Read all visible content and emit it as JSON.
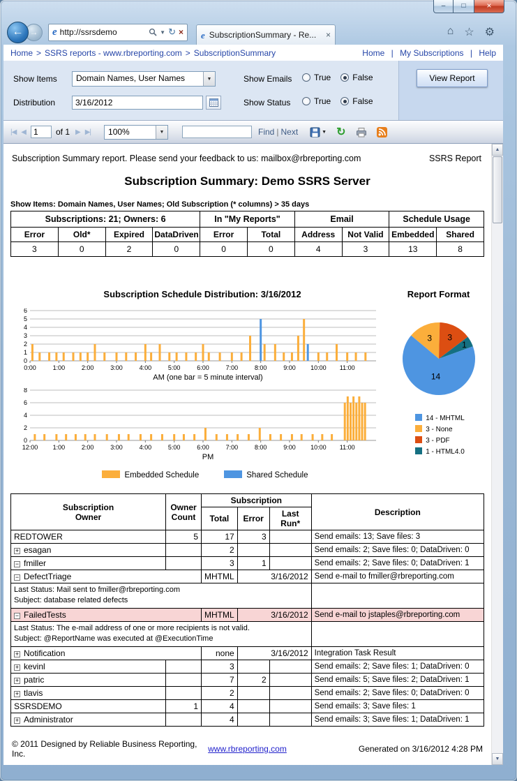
{
  "colors": {
    "embedded": "#FBAE3B",
    "shared": "#4E95E1",
    "pie_mhtml": "#4E95E1",
    "pie_none": "#FBAE3B",
    "pie_pdf": "#DC4E12",
    "pie_html40": "#157082",
    "row_highlight": "#F8D5D5",
    "link": "#2646A8"
  },
  "icons": {
    "favicon": "e",
    "back": "←",
    "forward": "→",
    "dropdown": "▼",
    "refresh": "↻",
    "stop": "×",
    "home": "⌂",
    "favorites": "☆",
    "tools": "⚙",
    "minimize": "–",
    "maximize": "□",
    "close": "×",
    "nav_first": "|◀",
    "nav_prev": "◀",
    "nav_next": "▶",
    "nav_last": "▶|",
    "scroll_up": "▲",
    "scroll_down": "▼"
  },
  "browser": {
    "address": "http://ssrsdemo",
    "tab_title": "SubscriptionSummary - Re..."
  },
  "breadcrumb": {
    "items": [
      "Home",
      "SSRS reports - www.rbreporting.com",
      "SubscriptionSummary"
    ],
    "separator": ">",
    "right_items": [
      "Home",
      "My Subscriptions",
      "Help"
    ],
    "right_separator": "|"
  },
  "parameters": {
    "show_items": {
      "label": "Show Items",
      "value": "Domain Names, User Names"
    },
    "show_emails": {
      "label": "Show Emails",
      "true_label": "True",
      "false_label": "False",
      "value": "False"
    },
    "distribution": {
      "label": "Distribution",
      "value": "3/16/2012"
    },
    "show_status": {
      "label": "Show Status",
      "true_label": "True",
      "false_label": "False",
      "value": "False"
    },
    "view_report": "View Report"
  },
  "toolbar": {
    "page": "1",
    "of": "of 1",
    "zoom": "100%",
    "find_value": "",
    "find": "Find",
    "next": "Next",
    "separator": "|"
  },
  "report": {
    "feedback": "Subscription Summary report. Please send your feedback to us: mailbox@rbreporting.com",
    "corner": "SSRS Report",
    "title": "Subscription Summary: Demo SSRS Server",
    "filter_line": "Show Items: Domain Names, User Names; Old Subscription (* columns) > 35 days",
    "footer": {
      "copyright": "© 2011 Designed by Reliable Business Reporting, Inc.",
      "link": "www.rbreporting.com",
      "generated": "Generated on 3/16/2012 4:28 PM"
    }
  },
  "summary_table": {
    "groups": [
      {
        "label": "Subscriptions: 21; Owners: 6",
        "columns": [
          [
            "Error",
            "3"
          ],
          [
            "Old*",
            "0"
          ],
          [
            "Expired",
            "2"
          ],
          [
            "DataDriven",
            "0"
          ]
        ]
      },
      {
        "label": "In \"My Reports\"",
        "columns": [
          [
            "Error",
            "0"
          ],
          [
            "Total",
            "0"
          ]
        ]
      },
      {
        "label": "Email",
        "columns": [
          [
            "Address",
            "4"
          ],
          [
            "Not Valid",
            "3"
          ]
        ]
      },
      {
        "label": "Schedule Usage",
        "columns": [
          [
            "Embedded",
            "13"
          ],
          [
            "Shared",
            "8"
          ]
        ]
      }
    ]
  },
  "chart_data": [
    {
      "type": "bar",
      "title": "Subscription Schedule Distribution: 3/16/2012",
      "caption": "AM (one bar = 5 minute interval)",
      "ylim": [
        0,
        6
      ],
      "yticks": [
        0,
        1,
        2,
        3,
        4,
        5,
        6
      ],
      "hours": 12,
      "xtick_labels": [
        "0:00",
        "1:00",
        "2:00",
        "3:00",
        "4:00",
        "5:00",
        "6:00",
        "7:00",
        "8:00",
        "9:00",
        "10:00",
        "11:00"
      ],
      "series_colors": {
        "e": "#FBAE3B",
        "s": "#4E95E1"
      },
      "series_names": {
        "e": "Embedded Schedule",
        "s": "Shared Schedule"
      },
      "bars": [
        [
          5,
          2,
          "e"
        ],
        [
          20,
          1,
          "e"
        ],
        [
          40,
          1,
          "e"
        ],
        [
          55,
          1,
          "e"
        ],
        [
          70,
          1,
          "e"
        ],
        [
          90,
          1,
          "e"
        ],
        [
          105,
          1,
          "e"
        ],
        [
          120,
          1,
          "e"
        ],
        [
          135,
          2,
          "e"
        ],
        [
          155,
          1,
          "e"
        ],
        [
          180,
          1,
          "e"
        ],
        [
          200,
          1,
          "e"
        ],
        [
          220,
          1,
          "e"
        ],
        [
          240,
          2,
          "e"
        ],
        [
          252,
          1,
          "e"
        ],
        [
          270,
          2,
          "e"
        ],
        [
          290,
          1,
          "e"
        ],
        [
          305,
          1,
          "e"
        ],
        [
          325,
          1,
          "e"
        ],
        [
          345,
          1,
          "e"
        ],
        [
          360,
          2,
          "e"
        ],
        [
          372,
          1,
          "e"
        ],
        [
          395,
          1,
          "e"
        ],
        [
          420,
          1,
          "e"
        ],
        [
          440,
          1,
          "e"
        ],
        [
          458,
          3,
          "e"
        ],
        [
          480,
          5,
          "s"
        ],
        [
          488,
          2,
          "e"
        ],
        [
          510,
          2,
          "e"
        ],
        [
          528,
          1,
          "e"
        ],
        [
          545,
          1,
          "e"
        ],
        [
          558,
          3,
          "e"
        ],
        [
          570,
          5,
          "e"
        ],
        [
          578,
          2,
          "s"
        ],
        [
          600,
          1,
          "e"
        ],
        [
          618,
          1,
          "e"
        ],
        [
          638,
          2,
          "e"
        ],
        [
          660,
          1,
          "e"
        ],
        [
          678,
          1,
          "e"
        ],
        [
          698,
          1,
          "e"
        ]
      ]
    },
    {
      "type": "bar",
      "caption": "PM",
      "ylim": [
        0,
        8
      ],
      "yticks": [
        0,
        2,
        4,
        6,
        8
      ],
      "hours": 12,
      "xtick_labels": [
        "12:00",
        "1:00",
        "2:00",
        "3:00",
        "4:00",
        "5:00",
        "6:00",
        "7:00",
        "8:00",
        "9:00",
        "10:00",
        "11:00"
      ],
      "series_colors": {
        "e": "#FBAE3B",
        "s": "#4E95E1"
      },
      "series_names": {
        "e": "Embedded Schedule",
        "s": "Shared Schedule"
      },
      "bars": [
        [
          10,
          1,
          "e"
        ],
        [
          30,
          1,
          "e"
        ],
        [
          55,
          1,
          "e"
        ],
        [
          75,
          1,
          "e"
        ],
        [
          95,
          1,
          "e"
        ],
        [
          115,
          1,
          "e"
        ],
        [
          135,
          1,
          "e"
        ],
        [
          160,
          1,
          "e"
        ],
        [
          185,
          1,
          "e"
        ],
        [
          205,
          1,
          "e"
        ],
        [
          230,
          1,
          "e"
        ],
        [
          252,
          1,
          "e"
        ],
        [
          275,
          1,
          "e"
        ],
        [
          300,
          1,
          "e"
        ],
        [
          320,
          1,
          "e"
        ],
        [
          342,
          1,
          "e"
        ],
        [
          365,
          2,
          "e"
        ],
        [
          388,
          1,
          "e"
        ],
        [
          410,
          1,
          "e"
        ],
        [
          432,
          1,
          "e"
        ],
        [
          455,
          1,
          "e"
        ],
        [
          478,
          2,
          "e"
        ],
        [
          500,
          1,
          "e"
        ],
        [
          522,
          1,
          "e"
        ],
        [
          545,
          1,
          "e"
        ],
        [
          565,
          1,
          "e"
        ],
        [
          588,
          1,
          "e"
        ],
        [
          608,
          1,
          "e"
        ],
        [
          628,
          1,
          "e"
        ],
        [
          655,
          6,
          "e"
        ],
        [
          661,
          7,
          "e"
        ],
        [
          667,
          6,
          "e"
        ],
        [
          673,
          7,
          "e"
        ],
        [
          679,
          6,
          "e"
        ],
        [
          685,
          7,
          "e"
        ],
        [
          691,
          6,
          "e"
        ],
        [
          697,
          6,
          "e"
        ]
      ]
    },
    {
      "type": "pie",
      "title": "Report Format",
      "start_angle": -50,
      "slices": [
        {
          "name": "None",
          "value": 3,
          "color": "#FBAE3B",
          "slice_label": "3",
          "label_r": 0.62
        },
        {
          "name": "PDF",
          "value": 3,
          "color": "#DC4E12",
          "slice_label": "3",
          "label_r": 0.66
        },
        {
          "name": "HTML4.0",
          "value": 1,
          "color": "#157082",
          "slice_label": "1",
          "label_r": 0.8
        },
        {
          "name": "MHTML",
          "value": 14,
          "color": "#4E95E1",
          "slice_label": "14",
          "label_r": 0.5
        }
      ],
      "legend": {
        "items": [
          {
            "label": "14 - MHTML",
            "color": "#4E95E1"
          },
          {
            "label": "3 - None",
            "color": "#FBAE3B"
          },
          {
            "label": "3 - PDF",
            "color": "#DC4E12"
          },
          {
            "label": "1 - HTML4.0",
            "color": "#157082"
          }
        ]
      }
    }
  ],
  "schedule_legend": {
    "items": [
      {
        "label": "Embedded Schedule",
        "color": "#FBAE3B"
      },
      {
        "label": "Shared Schedule",
        "color": "#4E95E1"
      }
    ]
  },
  "detail_table": {
    "headers": {
      "owner": "Subscription Owner",
      "count": "Owner Count",
      "group": "Subscription",
      "total": "Total",
      "error": "Error",
      "last_run": "Last Run*",
      "description": "Description"
    },
    "rows": [
      {
        "kind": "owner",
        "name": "REDTOWER",
        "count": "5",
        "total": "17",
        "error": "3",
        "description": "Send emails: 13; Save files: 3"
      },
      {
        "kind": "user",
        "icon": "plus",
        "name": "esagan",
        "total": "2",
        "description": "Send emails: 2; Save files: 0; DataDriven: 0"
      },
      {
        "kind": "user",
        "icon": "minus",
        "name": "fmiller",
        "total": "3",
        "error": "1",
        "description": "Send emails: 2; Save files: 0; DataDriven: 1"
      },
      {
        "kind": "sub",
        "icon": "minus",
        "name": "DefectTriage",
        "format": "MHTML",
        "last_run": "3/16/2012",
        "description": "Send e-mail to fmiller@rbreporting.com"
      },
      {
        "kind": "status",
        "line1": "Last Status: Mail sent to fmiller@rbreporting.com",
        "line2": "Subject: database related defects"
      },
      {
        "kind": "sub",
        "icon": "minus",
        "name": "FailedTests",
        "format": "MHTML",
        "last_run": "3/16/2012",
        "description": "Send e-mail to jstaples@rbreporting.com",
        "highlight": true
      },
      {
        "kind": "status",
        "line1": "Last Status: The e-mail address of one or more recipients is not valid.",
        "line2": "Subject: @ReportName was executed at @ExecutionTime"
      },
      {
        "kind": "sub",
        "icon": "plus",
        "name": "Notification",
        "format": "none",
        "last_run": "3/16/2012",
        "description": "Integration Task Result"
      },
      {
        "kind": "user",
        "icon": "plus",
        "name": "kevinl",
        "total": "3",
        "description": "Send emails: 2; Save files: 1; DataDriven: 0"
      },
      {
        "kind": "user",
        "icon": "plus",
        "name": "patric",
        "total": "7",
        "error": "2",
        "description": "Send emails: 5; Save files: 2; DataDriven: 1"
      },
      {
        "kind": "user",
        "icon": "plus",
        "name": "tlavis",
        "total": "2",
        "description": "Send emails: 2; Save files: 0; DataDriven: 0"
      },
      {
        "kind": "owner",
        "name": "SSRSDEMO",
        "count": "1",
        "total": "4",
        "description": "Send emails: 3; Save files: 1"
      },
      {
        "kind": "user",
        "icon": "plus",
        "name": "Administrator",
        "total": "4",
        "description": "Send emails: 3; Save files: 1; DataDriven: 1"
      }
    ]
  }
}
